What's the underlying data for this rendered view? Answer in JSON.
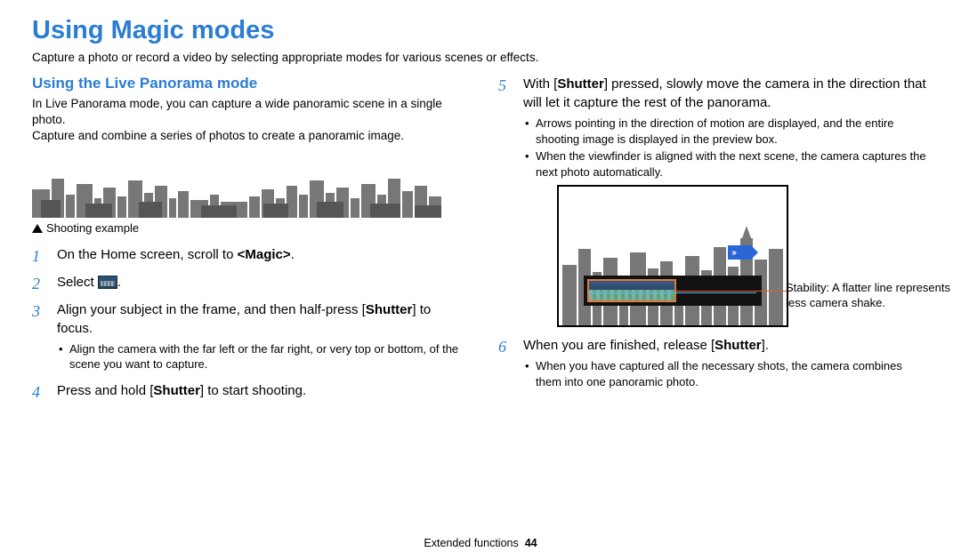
{
  "title": "Using Magic modes",
  "intro": "Capture a photo or record a video by selecting appropriate modes for various scenes or effects.",
  "subhead": "Using the Live Panorama mode",
  "desc1": "In Live Panorama mode, you can capture a wide panoramic scene in a single photo.",
  "desc2": "Capture and combine a series of photos to create a panoramic image.",
  "shooting_caption": "Shooting example",
  "steps": {
    "s1a": "On the Home screen, scroll to ",
    "s1b": "<Magic>",
    "s1c": ".",
    "s2a": "Select ",
    "s2b": ".",
    "s3a": "Align your subject in the frame, and then half-press [",
    "s3b": "Shutter",
    "s3c": "] to focus.",
    "s3_sub1": "Align the camera with the far left or the far right, or very top or bottom, of the scene you want to capture.",
    "s4a": "Press and hold [",
    "s4b": "Shutter",
    "s4c": "] to start shooting.",
    "s5a": "With [",
    "s5b": "Shutter",
    "s5c": "] pressed, slowly move the camera in the direction that will let it capture the rest of the panorama.",
    "s5_sub1": "Arrows pointing in the direction of motion are displayed, and the entire shooting image is displayed in the preview box.",
    "s5_sub2": "When the viewfinder is aligned with the next scene, the camera captures the next photo automatically.",
    "s6a": "When you are finished, release [",
    "s6b": "Shutter",
    "s6c": "].",
    "s6_sub1": "When you have captured all the necessary shots, the camera combines them into one panoramic photo."
  },
  "annotation": "Stability: A flatter line represents less camera shake.",
  "footer_section": "Extended functions",
  "footer_page": "44"
}
